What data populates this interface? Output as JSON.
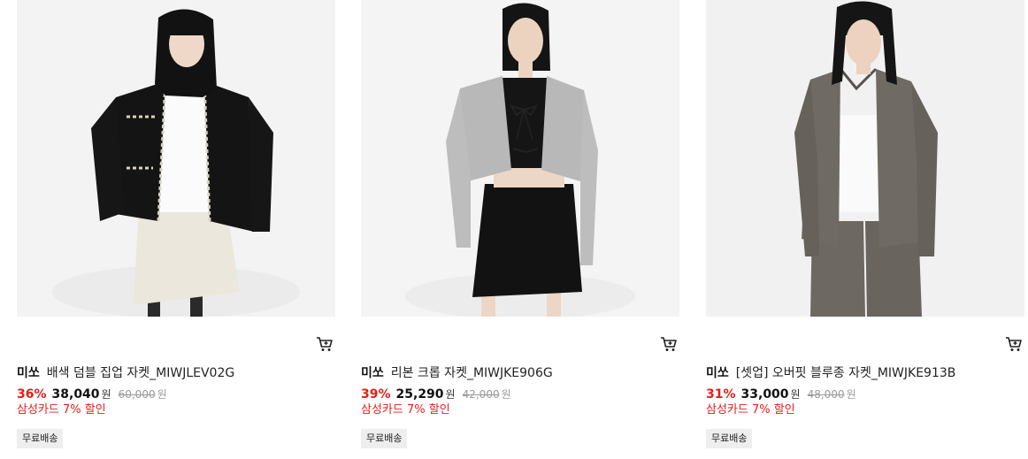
{
  "products": [
    {
      "brand": "미쏘",
      "name": "배색 덤블 집업 자켓_MIWJLEV02G",
      "discount": "36%",
      "price": "38,040",
      "currency": "원",
      "original_price": "60,000",
      "card_promo": "삼성카드 7% 할인",
      "badge": "무료배송",
      "image_alt": "black tweed zip-up jacket",
      "cart_icon": "cart-icon"
    },
    {
      "brand": "미쏘",
      "name": "리본 크롭 자켓_MIWJKE906G",
      "discount": "39%",
      "price": "25,290",
      "currency": "원",
      "original_price": "42,000",
      "card_promo": "삼성카드 7% 할인",
      "badge": "무료배송",
      "image_alt": "grey ribbon cropped jacket",
      "cart_icon": "cart-icon"
    },
    {
      "brand": "미쏘",
      "name": "[셋업] 오버핏 블루종 자켓_MIWJKE913B",
      "discount": "31%",
      "price": "33,000",
      "currency": "원",
      "original_price": "48,000",
      "card_promo": "삼성카드 7% 할인",
      "badge": "무료배송",
      "image_alt": "grey oversized blouson jacket setup",
      "cart_icon": "cart-icon"
    }
  ],
  "colors": {
    "discount": "#e0201b",
    "badge_bg": "#eeeeee",
    "photo_bg": "#f2f2f2"
  }
}
